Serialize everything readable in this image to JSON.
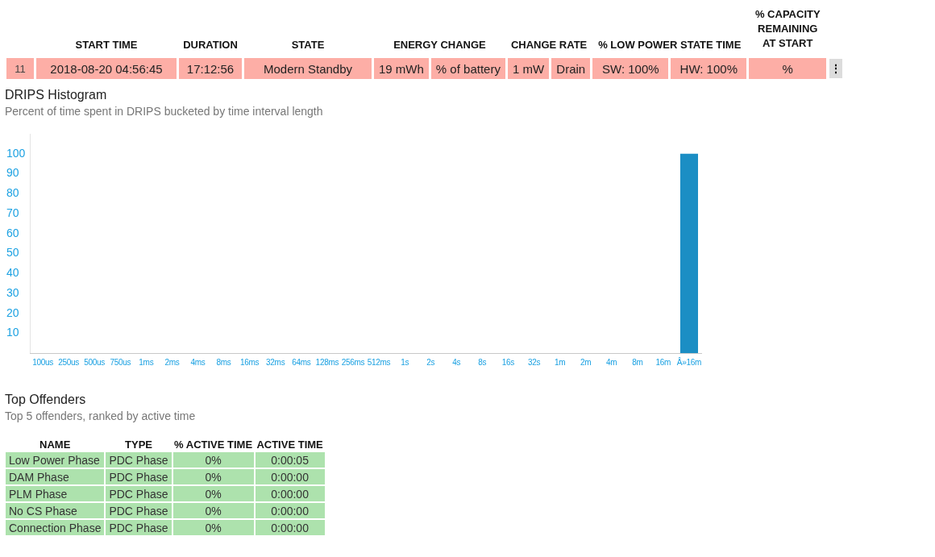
{
  "session_table": {
    "columns": [
      "START TIME",
      "DURATION",
      "STATE",
      "ENERGY CHANGE",
      "CHANGE RATE",
      "% LOW POWER STATE TIME",
      "% CAPACITY REMAINING AT START"
    ],
    "row": {
      "cells": [
        "11",
        "2018-08-20  04:56:45",
        "17:12:56",
        "Modern Standby",
        "19 mWh",
        "% of battery",
        "1 mW",
        "Drain",
        "SW: 100%",
        "HW: 100%",
        "%"
      ],
      "menu": "⋮"
    }
  },
  "histogram": {
    "title": "DRIPS Histogram",
    "subtitle": "Percent of time spent in DRIPS bucketed by time interval length",
    "chart_data": {
      "type": "bar",
      "categories": [
        "100us",
        "250us",
        "500us",
        "750us",
        "1ms",
        "2ms",
        "4ms",
        "8ms",
        "16ms",
        "32ms",
        "64ms",
        "128ms",
        "256ms",
        "512ms",
        "1s",
        "2s",
        "4s",
        "8s",
        "16s",
        "32s",
        "1m",
        "2m",
        "4m",
        "8m",
        "16m",
        "Â»16m"
      ],
      "series": [
        {
          "color": "#1b8ec4",
          "values": [
            0,
            0,
            0,
            0,
            0,
            0,
            0,
            0,
            0,
            0,
            0,
            0,
            0,
            0,
            0,
            0,
            0,
            0,
            0,
            0,
            0,
            0,
            0,
            0,
            0,
            100
          ]
        }
      ],
      "ylim": [
        0,
        110
      ],
      "yticks": [
        10,
        20,
        30,
        40,
        50,
        60,
        70,
        80,
        90,
        100
      ]
    }
  },
  "offenders": {
    "title": "Top Offenders",
    "subtitle": "Top 5 offenders, ranked by active time",
    "columns": [
      "NAME",
      "TYPE",
      "% ACTIVE TIME",
      "ACTIVE TIME"
    ],
    "rows": [
      [
        "Low Power Phase",
        "PDC Phase",
        "0%",
        "0:00:05"
      ],
      [
        "DAM Phase",
        "PDC Phase",
        "0%",
        "0:00:00"
      ],
      [
        "PLM Phase",
        "PDC Phase",
        "0%",
        "0:00:00"
      ],
      [
        "No CS Phase",
        "PDC Phase",
        "0%",
        "0:00:00"
      ],
      [
        "Connection Phase",
        "PDC Phase",
        "0%",
        "0:00:00"
      ]
    ]
  }
}
